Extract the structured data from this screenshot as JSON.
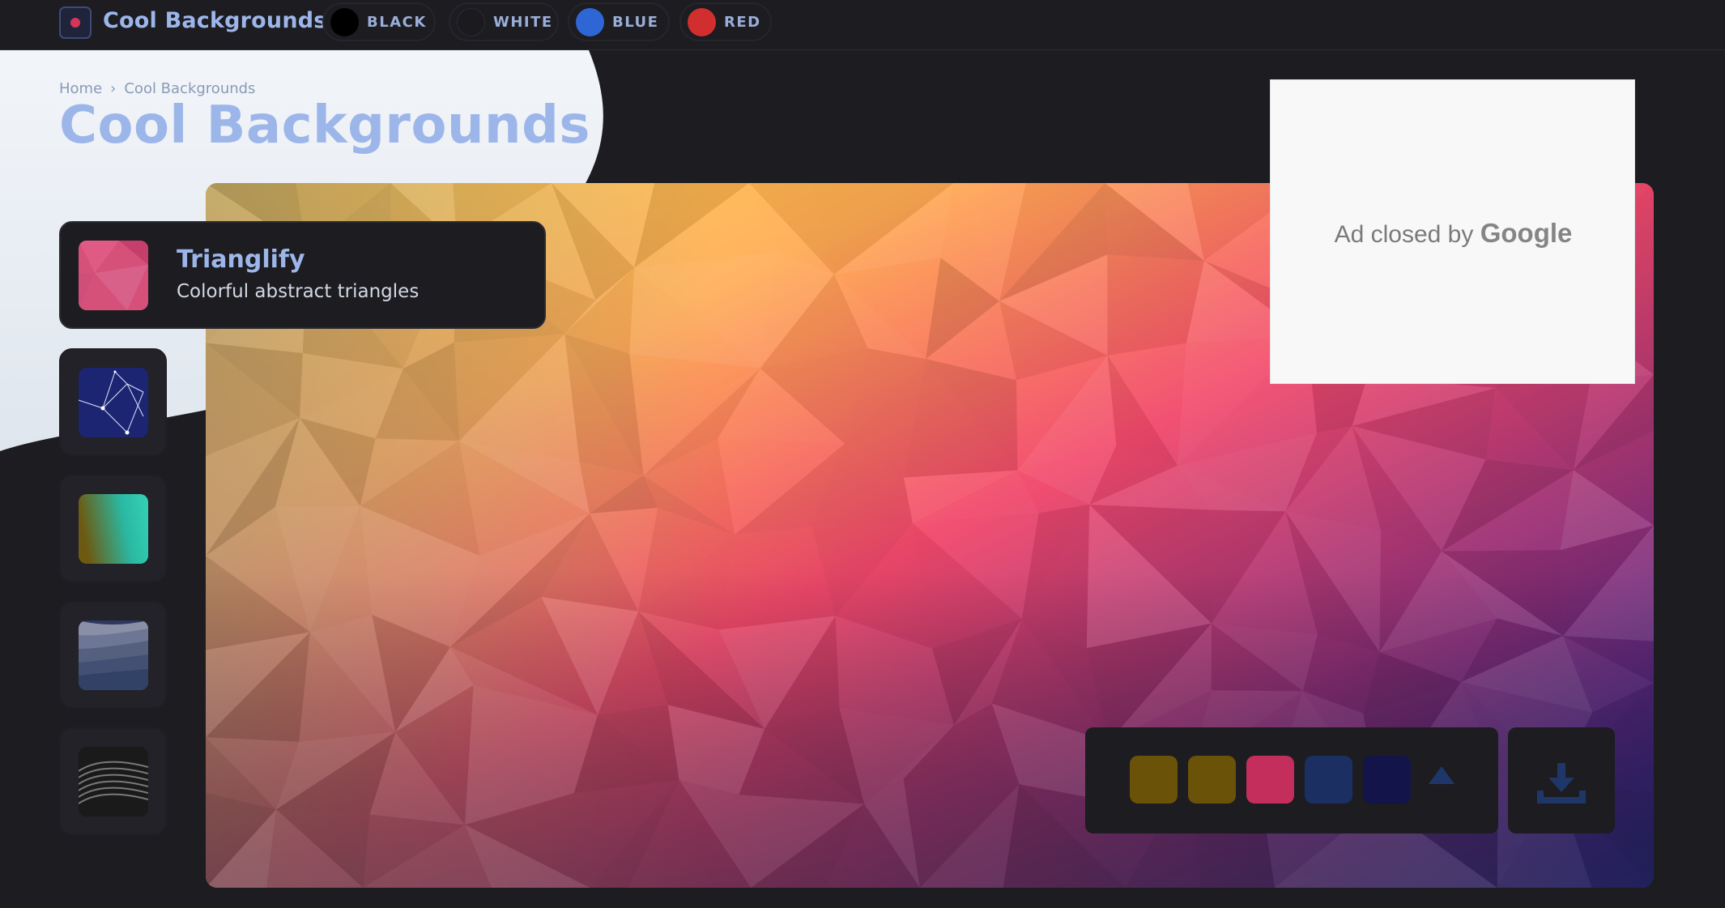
{
  "nav": {
    "site_title": "Cool Backgrounds",
    "logo_icon": "logo-icon",
    "colors": [
      {
        "label": "BLACK",
        "dot": "#000000"
      },
      {
        "label": "WHITE",
        "dot": "#1a1a1f"
      },
      {
        "label": "BLUE",
        "dot": "#2f66d6"
      },
      {
        "label": "RED",
        "dot": "#d12f2f"
      }
    ]
  },
  "breadcrumb": {
    "home": "Home",
    "separator": "›",
    "current": "Cool Backgrounds"
  },
  "page_title": "Cool Backgrounds",
  "patterns": {
    "active": {
      "name": "Trianglify",
      "description": "Colorful abstract triangles",
      "thumb_color": "#d6517a"
    },
    "others": [
      {
        "thumb": "particles-network-thumbnail",
        "color": "#1c2572"
      },
      {
        "thumb": "gradient-thumbnail",
        "color": "#2ab9a3"
      },
      {
        "thumb": "layered-waves-thumbnail",
        "color": "#3a4a78"
      },
      {
        "thumb": "3d-waves-thumbnail",
        "color": "#4b4b4b"
      }
    ]
  },
  "ad": {
    "prefix": "Ad closed by",
    "brand": "Google"
  },
  "palette": {
    "swatches": [
      "#6b5209",
      "#6b5209",
      "#c42e5d",
      "#1b2f63",
      "#13144a"
    ],
    "add_icon": "triangle-add-icon"
  },
  "download": {
    "icon": "download-icon"
  },
  "colors": {
    "background": "#1c1c21",
    "accent": "#9db6ea",
    "swoosh": "#f2f5f9"
  }
}
